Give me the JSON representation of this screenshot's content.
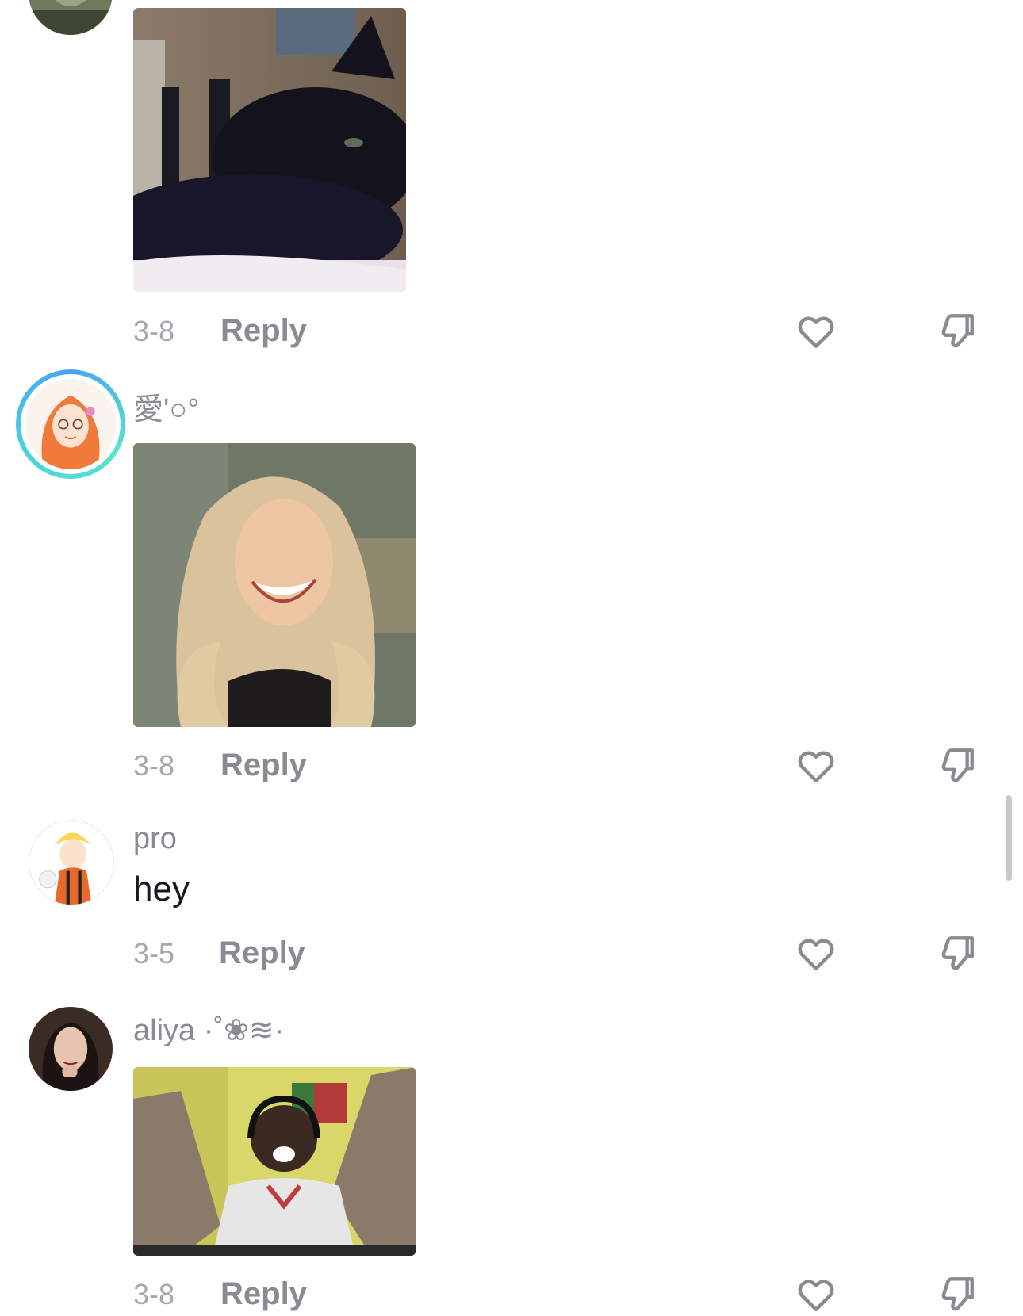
{
  "comments": [
    {
      "username": "",
      "date": "3-8",
      "reply_label": "Reply",
      "media_icon": "black-cat-gif",
      "avatar_icon": "user-avatar"
    },
    {
      "username": "愛'○°",
      "date": "3-8",
      "reply_label": "Reply",
      "media_icon": "smiling-blonde-woman-gif",
      "avatar_icon": "anime-girl-orange-hair-avatar",
      "story_ring_colors": [
        "#4aa3f0",
        "#5be3c8"
      ]
    },
    {
      "username": "pro",
      "text": "hey",
      "date": "3-5",
      "reply_label": "Reply",
      "avatar_icon": "anime-boy-yellow-hair-avatar"
    },
    {
      "username": "aliya ·˚❀≋·",
      "date": "3-8",
      "reply_label": "Reply",
      "media_icon": "excited-man-headset-gif",
      "avatar_icon": "woman-dark-hair-avatar"
    }
  ],
  "icons": {
    "like": "heart-outline-icon",
    "dislike": "thumbs-down-outline-icon"
  },
  "colors": {
    "username": "#8a8b91",
    "date": "#a7a8ad",
    "text": "#161823",
    "icon": "#8a8b91"
  }
}
